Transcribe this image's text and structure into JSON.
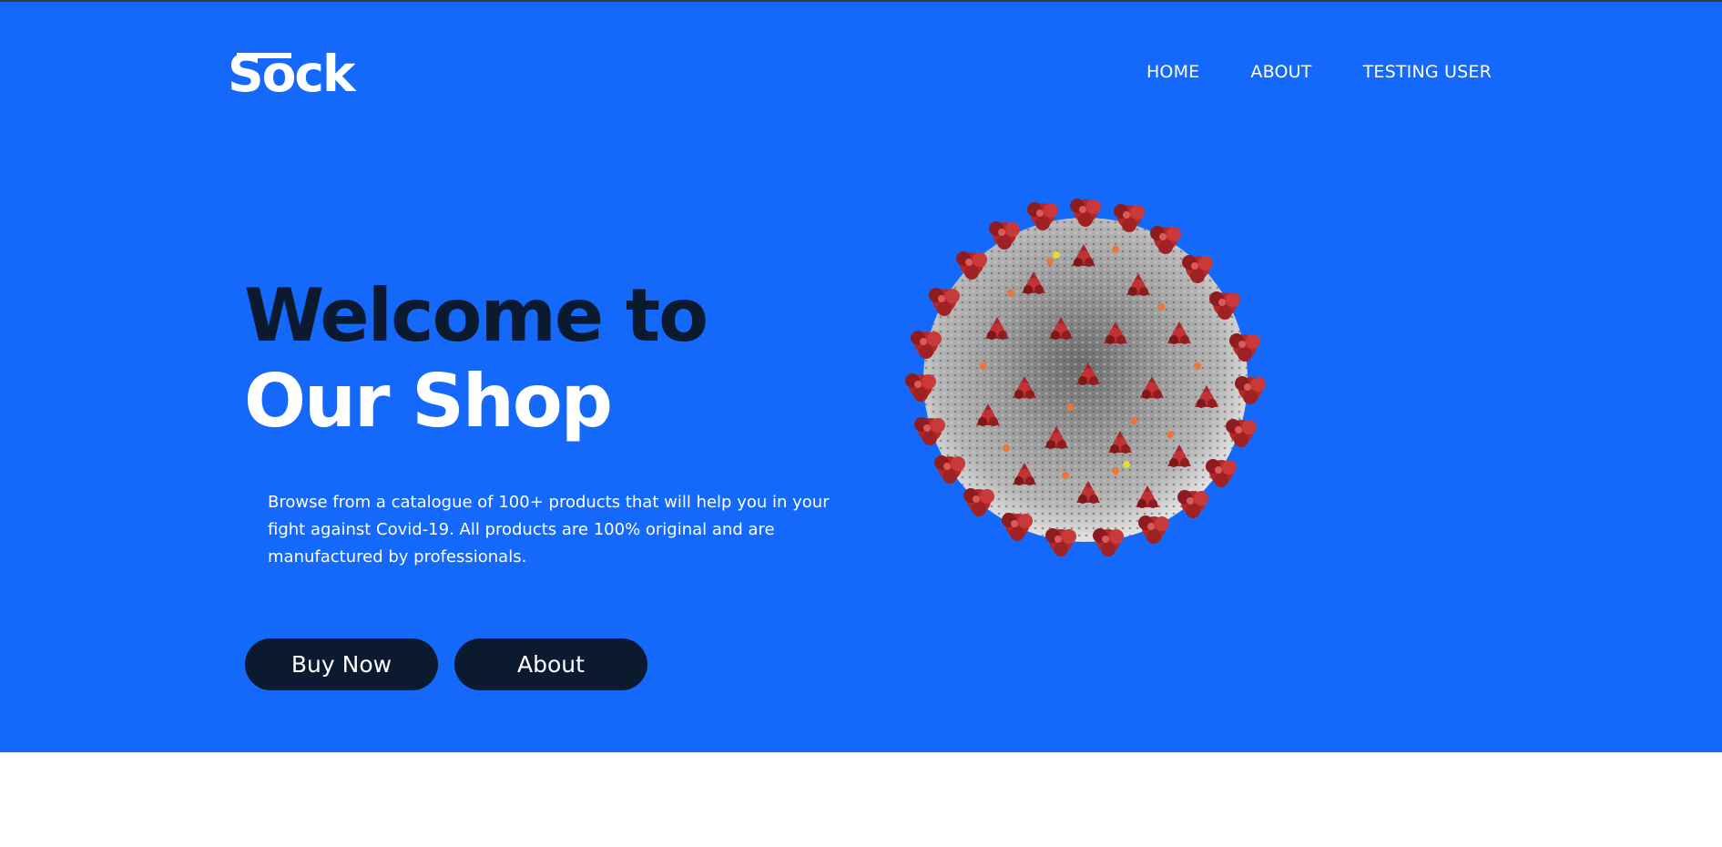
{
  "header": {
    "logo_text": "Sock",
    "nav": [
      {
        "label": "HOME"
      },
      {
        "label": "ABOUT"
      },
      {
        "label": "TESTING USER"
      }
    ]
  },
  "hero": {
    "title_line1": "Welcome to",
    "title_line2": "Our Shop",
    "description": "Browse from a catalogue of 100+ products that will help you in your fight against Covid-19. All products are 100% original and are manufactured by professionals.",
    "buttons": {
      "buy_label": "Buy Now",
      "about_label": "About"
    },
    "image": "coronavirus-illustration"
  },
  "colors": {
    "hero_bg": "#1469fa",
    "dark_navy": "#0c1a30",
    "white": "#ffffff",
    "virus_red": "#b5282a",
    "virus_gray": "#9a9a9a"
  }
}
